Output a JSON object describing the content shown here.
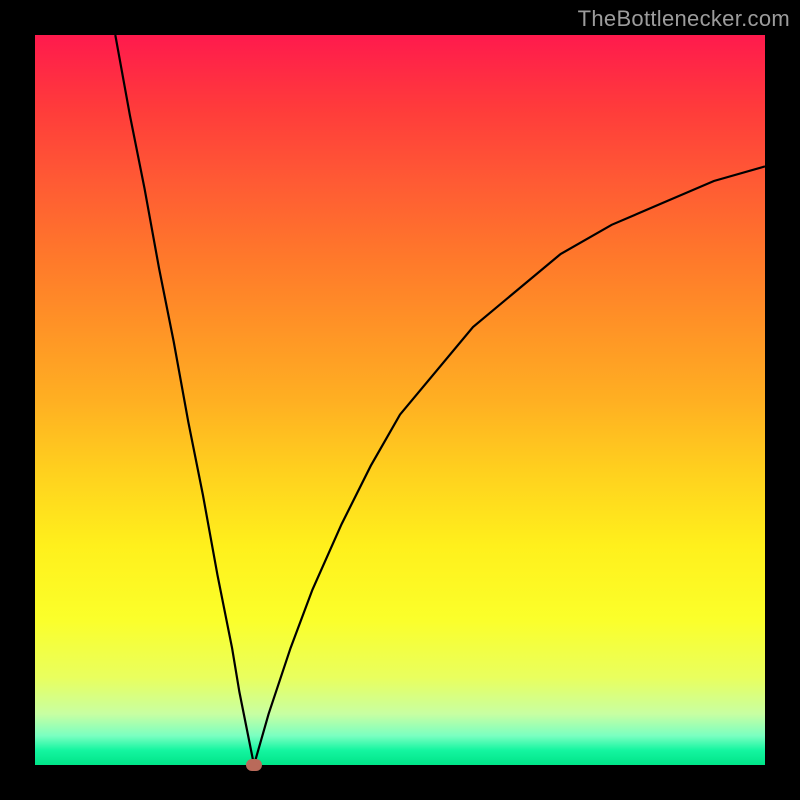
{
  "watermark": {
    "text": "TheBottlenecker.com"
  },
  "colors": {
    "page_bg": "#000000",
    "gradient_top": "#ff1a4d",
    "gradient_bottom": "#00e488",
    "curve": "#000000",
    "dot": "#b96a5a"
  },
  "chart_data": {
    "type": "line",
    "title": "",
    "xlabel": "",
    "ylabel": "",
    "xlim": [
      0,
      100
    ],
    "ylim": [
      0,
      100
    ],
    "grid": false,
    "legend": false,
    "annotations": [],
    "minimum_point": {
      "x": 30,
      "y": 0
    },
    "series": [
      {
        "name": "left-branch",
        "x": [
          11,
          13,
          15,
          17,
          19,
          21,
          23,
          25,
          27,
          28,
          29,
          30
        ],
        "y": [
          100,
          89,
          79,
          68,
          58,
          47,
          37,
          26,
          16,
          10,
          5,
          0
        ]
      },
      {
        "name": "right-branch",
        "x": [
          30,
          32,
          35,
          38,
          42,
          46,
          50,
          55,
          60,
          66,
          72,
          79,
          86,
          93,
          100
        ],
        "y": [
          0,
          7,
          16,
          24,
          33,
          41,
          48,
          54,
          60,
          65,
          70,
          74,
          77,
          80,
          82
        ]
      }
    ]
  }
}
